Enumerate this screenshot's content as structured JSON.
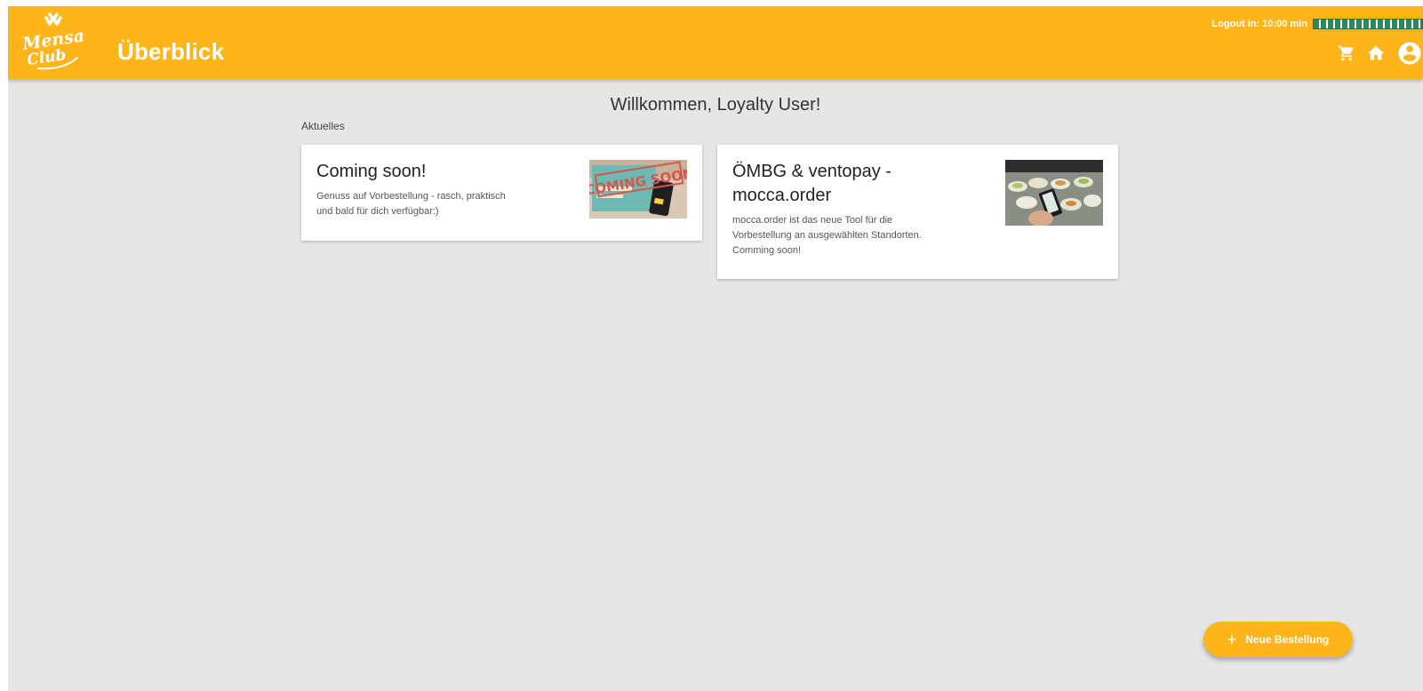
{
  "header": {
    "logo_text": "Mensa Club",
    "title": "Überblick",
    "logout_label": "Logout in: 10:00 min",
    "logout_progress": 1.0,
    "icons": [
      "cart-icon",
      "home-icon",
      "account-icon"
    ],
    "brand_color": "#fdb519"
  },
  "main": {
    "welcome": "Willkommen, Loyalty User!",
    "section_label": "Aktuelles",
    "news": [
      {
        "title": "Coming soon!",
        "body": "Genuss auf Vorbestellung - rasch, praktisch und bald für dich verfügbar:)",
        "image_text": "COMING SOON"
      },
      {
        "title": "ÖMBG & ventopay - mocca.order",
        "body": "mocca.order ist das neue Tool für die Vorbestellung an ausgewählten Standorten. Comming soon!"
      }
    ]
  },
  "fab": {
    "icon": "plus-icon",
    "label": "Neue Bestellung"
  }
}
